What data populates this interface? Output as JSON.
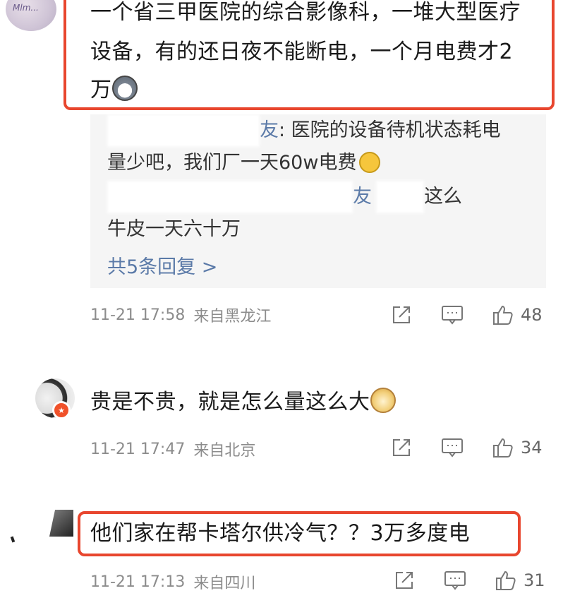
{
  "comments": [
    {
      "text_line1": "一个省三甲医院的综合影像科，一堆大型医疗",
      "text_line2": "设备，有的还日夜不能断电，一个月电费才2",
      "text_line3": "万",
      "emoji": "husky-emoji",
      "avatar_text": "Mlm...",
      "replies": [
        {
          "author": "友",
          "text_line1": ": 医院的设备待机状态耗电",
          "text_line2": "量少吧，我们厂一天60w电费",
          "emoji": "laugh-cry-emoji"
        },
        {
          "author": "友",
          "text_line1": "这么",
          "text_line2": "牛皮一天六十万"
        }
      ],
      "more_replies": "共5条回复 >",
      "time": "11-21 17:58",
      "location": "来自黑龙江",
      "likes": "48",
      "highlighted": true
    },
    {
      "text": "贵是不贵，就是怎么量这么大",
      "emoji": "doge-emoji",
      "time": "11-21 17:47",
      "location": "来自北京",
      "likes": "34",
      "highlighted": false
    },
    {
      "text": "他们家在帮卡塔尔供冷气？？3万多度电",
      "time": "11-21 17:13",
      "location": "来自四川",
      "likes": "31",
      "highlighted": true
    }
  ],
  "colors": {
    "highlight_border": "#e8462e",
    "link_blue": "#5b7aa8",
    "meta_gray": "#8c8c8c",
    "reply_bg": "#f5f5f5",
    "vip_badge": "#f0512a"
  },
  "icons": [
    "share-icon",
    "comment-icon",
    "like-icon",
    "vip-badge-icon"
  ]
}
